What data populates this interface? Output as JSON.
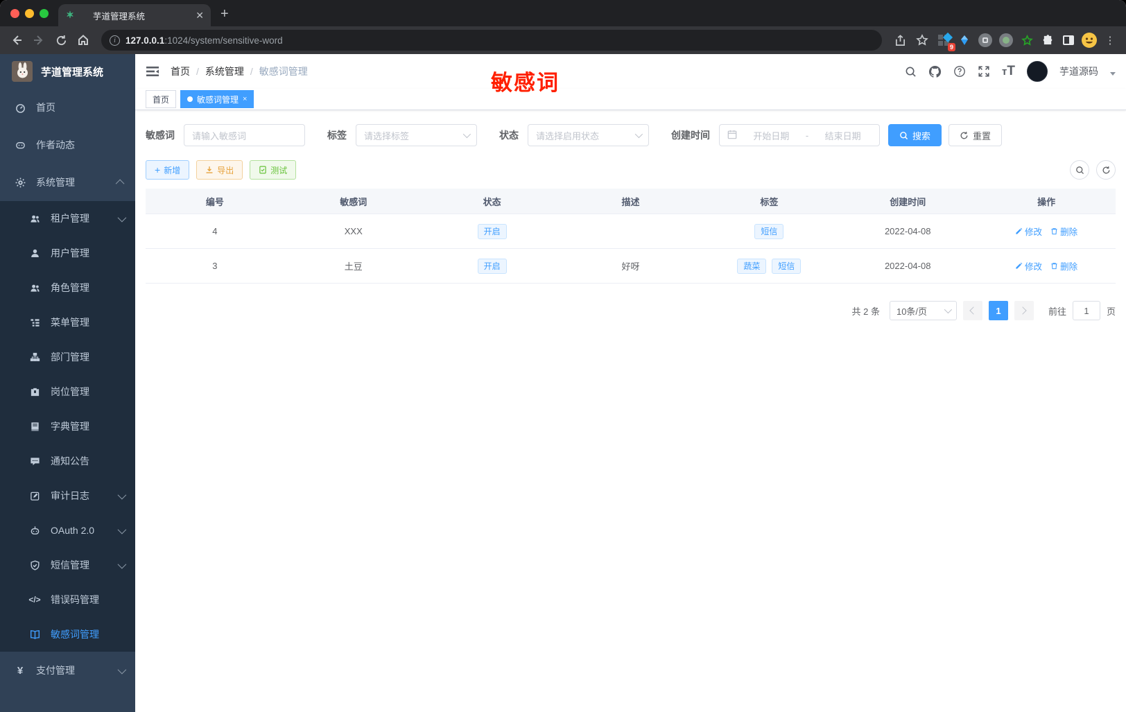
{
  "browser": {
    "tab_title": "芋道管理系统",
    "url_host": "127.0.0.1",
    "url_path": ":1024/system/sensitive-word",
    "extension_badge": "9"
  },
  "sidebar": {
    "title": "芋道管理系统",
    "items": [
      {
        "label": "首页"
      },
      {
        "label": "作者动态"
      },
      {
        "label": "系统管理"
      },
      {
        "label": "租户管理"
      },
      {
        "label": "用户管理"
      },
      {
        "label": "角色管理"
      },
      {
        "label": "菜单管理"
      },
      {
        "label": "部门管理"
      },
      {
        "label": "岗位管理"
      },
      {
        "label": "字典管理"
      },
      {
        "label": "通知公告"
      },
      {
        "label": "审计日志"
      },
      {
        "label": "OAuth 2.0"
      },
      {
        "label": "短信管理"
      },
      {
        "label": "错误码管理"
      },
      {
        "label": "敏感词管理"
      },
      {
        "label": "支付管理"
      }
    ]
  },
  "navbar": {
    "breadcrumb": [
      "首页",
      "系统管理",
      "敏感词管理"
    ],
    "username": "芋道源码"
  },
  "annotation": {
    "text": "敏感词",
    "color": "#ff2000"
  },
  "tags_view": {
    "home": "首页",
    "active": "敏感词管理",
    "close": "×"
  },
  "filters": {
    "keyword_label": "敏感词",
    "keyword_placeholder": "请输入敏感词",
    "tag_label": "标签",
    "tag_placeholder": "请选择标签",
    "status_label": "状态",
    "status_placeholder": "请选择启用状态",
    "date_label": "创建时间",
    "date_start_placeholder": "开始日期",
    "date_separator": "-",
    "date_end_placeholder": "结束日期",
    "search_label": "搜索",
    "reset_label": "重置"
  },
  "actions": {
    "add_label": "新增",
    "export_label": "导出",
    "test_label": "测试"
  },
  "table": {
    "columns": [
      "编号",
      "敏感词",
      "状态",
      "描述",
      "标签",
      "创建时间",
      "操作"
    ],
    "rows": [
      {
        "id": "4",
        "word": "XXX",
        "status": "开启",
        "desc": "",
        "tags": [
          "短信"
        ],
        "created": "2022-04-08"
      },
      {
        "id": "3",
        "word": "土豆",
        "status": "开启",
        "desc": "好呀",
        "tags": [
          "蔬菜",
          "短信"
        ],
        "created": "2022-04-08"
      }
    ],
    "edit_label": "修改",
    "delete_label": "删除"
  },
  "pagination": {
    "total": "共 2 条",
    "page_size": "10条/页",
    "current_page": "1",
    "goto_label": "前往",
    "goto_value": "1",
    "unit_label": "页"
  },
  "colors": {
    "primary": "#409eff",
    "success": "#67c23a",
    "warning": "#e6a23c",
    "sidebar_bg": "#304156",
    "submenu_bg": "#1f2d3d",
    "annotation_red": "#ff2000"
  }
}
